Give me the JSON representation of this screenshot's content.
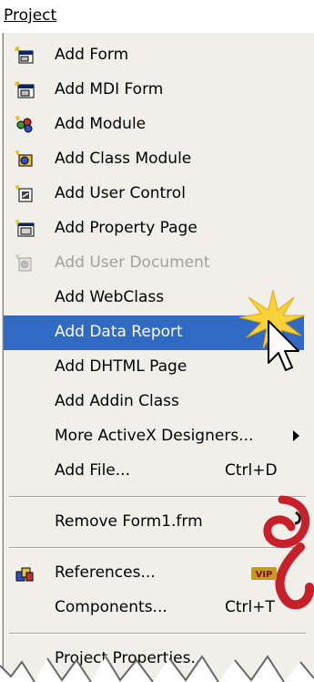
{
  "menubar": {
    "title": "Project"
  },
  "menu": {
    "items": [
      {
        "label": "Add Form",
        "icon": "form-icon",
        "enabled": true
      },
      {
        "label": "Add MDI Form",
        "icon": "mdi-form-icon",
        "enabled": true
      },
      {
        "label": "Add Module",
        "icon": "module-icon",
        "enabled": true
      },
      {
        "label": "Add Class Module",
        "icon": "class-module-icon",
        "enabled": true
      },
      {
        "label": "Add User Control",
        "icon": "user-control-icon",
        "enabled": true
      },
      {
        "label": "Add Property Page",
        "icon": "property-page-icon",
        "enabled": true
      },
      {
        "label": "Add User Document",
        "icon": "user-document-icon",
        "enabled": false
      },
      {
        "label": "Add WebClass",
        "enabled": true
      },
      {
        "label": "Add Data Report",
        "enabled": true,
        "selected": true
      },
      {
        "label": "Add DHTML Page",
        "enabled": true
      },
      {
        "label": "Add Addin Class",
        "enabled": true
      },
      {
        "label": "More ActiveX Designers...",
        "enabled": true,
        "submenu": true
      },
      {
        "label": "Add File...",
        "shortcut": "Ctrl+D",
        "enabled": true
      },
      {
        "label": "Remove Form1.frm",
        "enabled": true
      },
      {
        "label": "References...",
        "icon": "references-icon",
        "enabled": true
      },
      {
        "label": "Components...",
        "shortcut": "Ctrl+T",
        "enabled": true
      },
      {
        "label": "Project Properties...",
        "enabled": true
      }
    ]
  },
  "decor": {
    "badge": "VIP"
  },
  "colors": {
    "menu_bg": "#f0efea",
    "highlight": "#316ac5",
    "disabled_text": "#a3a19a",
    "watermark_red": "#c8202a"
  }
}
